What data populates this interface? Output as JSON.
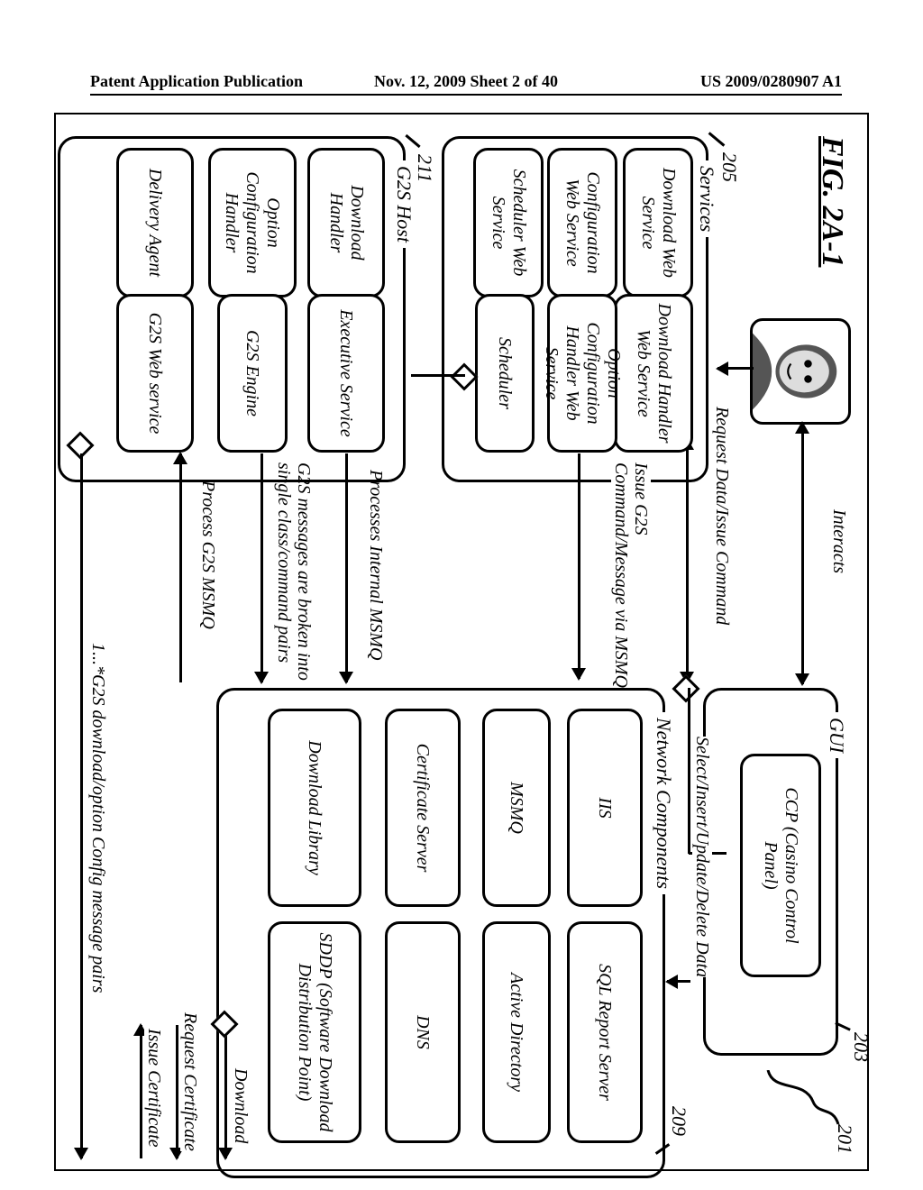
{
  "header": {
    "left": "Patent Application Publication",
    "mid": "Nov. 12, 2009  Sheet 2 of 40",
    "right": "US 2009/0280907 A1"
  },
  "fig_title": "FIG. 2A-1",
  "refs": {
    "r201": "201",
    "r203": "203",
    "r205": "205",
    "r209": "209",
    "r211": "211"
  },
  "groups": {
    "gui": "GUI",
    "services": "Services",
    "network": "Network Components",
    "g2s_host": "G2S Host"
  },
  "gui": {
    "ccp": "CCP (Casino Control\nPanel)"
  },
  "svc": {
    "dl_ws": "Download\nWeb Service",
    "cfg_ws": "Configuration\nWeb Service",
    "sched_ws": "Scheduler\nWeb Service",
    "dl_hdlr_ws": "Download\nHandler Web\nService",
    "optcfg_hdlr_ws": "Option Configuration\nHandler Web Service",
    "scheduler": "Scheduler"
  },
  "net": {
    "iis": "IIS",
    "sql_report": "SQL Report\nServer",
    "msmq": "MSMQ",
    "ad": "Active Directory",
    "cert_srv": "Certificate\nServer",
    "dns": "DNS",
    "dl_lib": "Download\nLibrary",
    "sddp": "SDDP (Software\nDownload Distribution\nPoint)"
  },
  "host": {
    "dl_handler": "Download\nHandler",
    "exec_svc": "Executive\nService",
    "opt_cfg_handler": "Option\nConfiguration\nHandler",
    "g2s_engine": "G2S Engine",
    "delivery_agent": "Delivery\nAgent",
    "g2s_ws": "G2S Web\nservice"
  },
  "labels": {
    "interacts": "Interacts",
    "req_data": "Request Data/Issue Command",
    "select_insert": "Select/Insert/Update/Delete Data",
    "issue_g2s": "Issue G2S\nCommand/Message via MSMQ",
    "proc_internal_msmq": "Processes Internal MSMQ",
    "g2s_broken": "G2S messages are broken into\nsingle class/command pairs",
    "process_g2s_msmq": "Process G2S MSMQ",
    "download": "Download",
    "req_cert": "Request Certificate",
    "issue_cert": "Issue Certificate",
    "g2s_pairs": "1...*G2S download/option Config message pairs"
  }
}
